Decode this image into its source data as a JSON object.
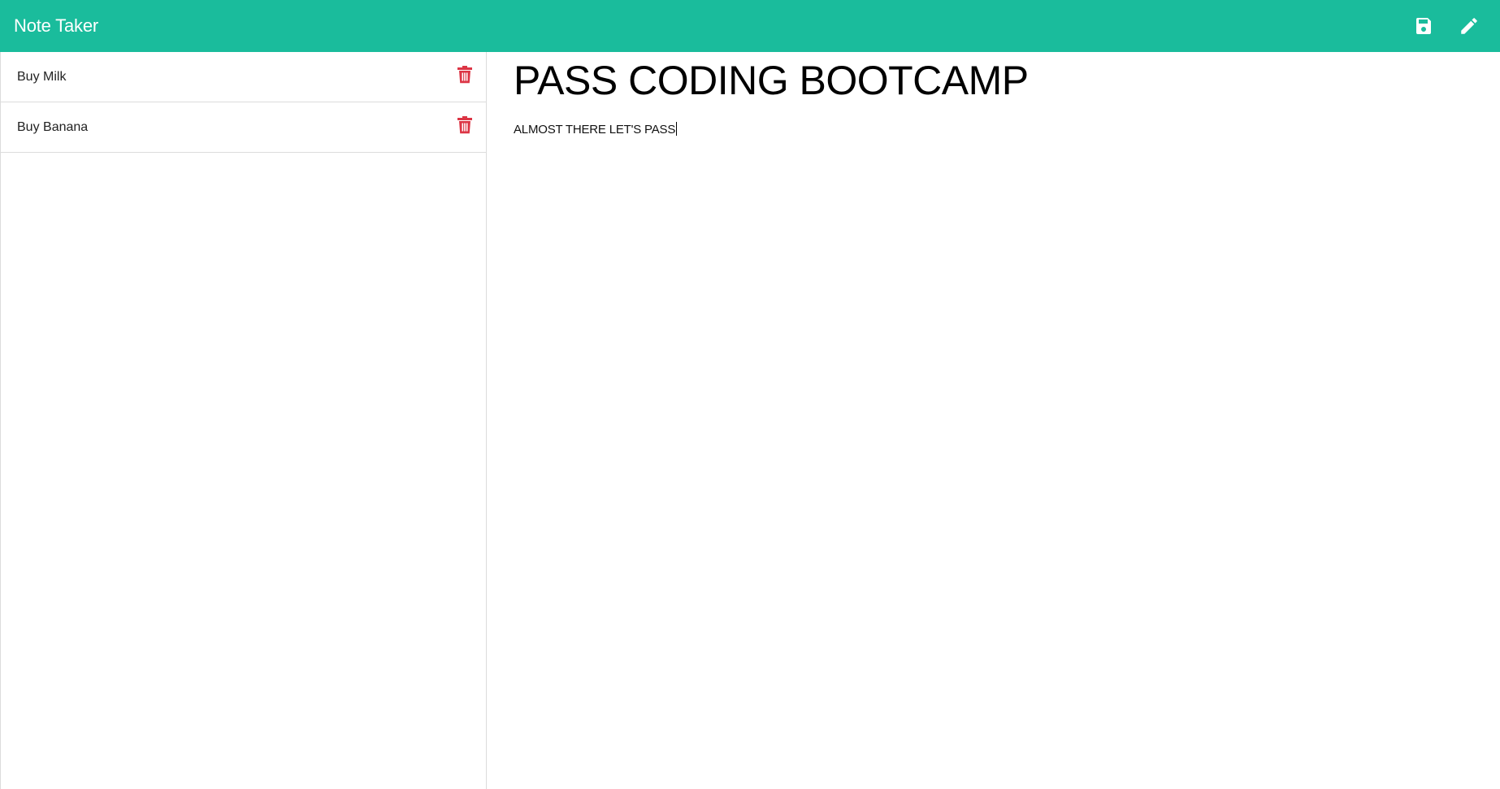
{
  "navbar": {
    "brand": "Note Taker",
    "save_icon": "save-icon",
    "new_note_icon": "pencil-icon",
    "color": "#1abc9c"
  },
  "notes": [
    {
      "title": "Buy Milk",
      "delete_icon": "trash-icon"
    },
    {
      "title": "Buy Banana",
      "delete_icon": "trash-icon"
    }
  ],
  "editor": {
    "title": "PASS CODING BOOTCAMP",
    "text": "ALMOST THERE LET'S PASS"
  },
  "colors": {
    "accent": "#1abc9c",
    "delete": "#dc3545"
  }
}
